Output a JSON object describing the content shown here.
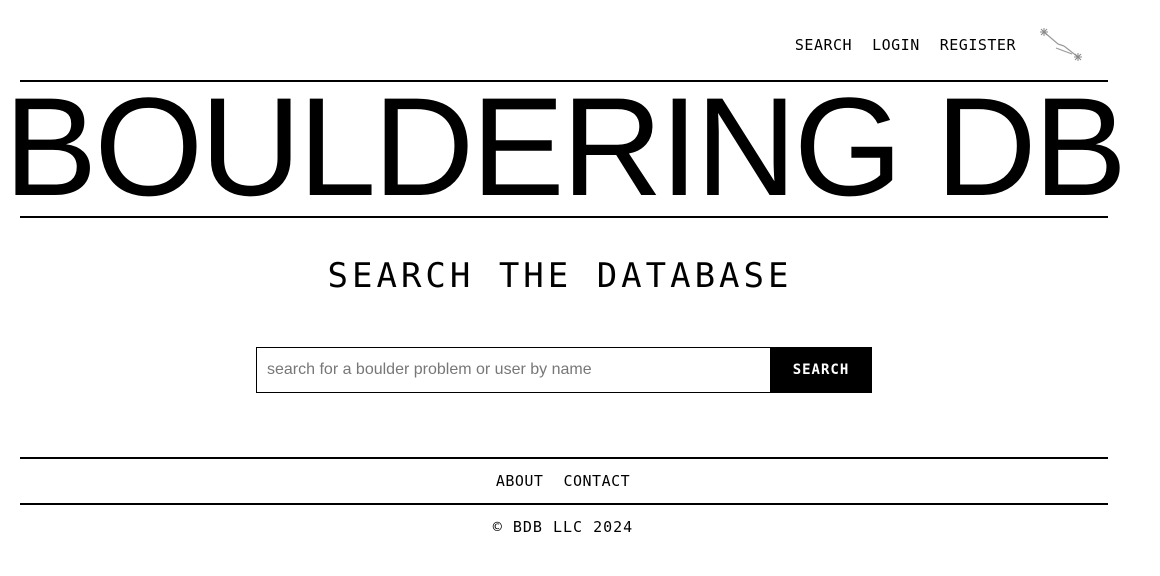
{
  "header": {
    "nav": [
      {
        "label": "SEARCH"
      },
      {
        "label": "LOGIN"
      },
      {
        "label": "REGISTER"
      }
    ],
    "logo_icon": "constellation-icon"
  },
  "title": "BOULDERING DB",
  "main": {
    "heading": "SEARCH THE DATABASE",
    "search": {
      "placeholder": "search for a boulder problem or user by name",
      "value": "",
      "button_label": "SEARCH"
    }
  },
  "footer": {
    "links": [
      {
        "label": "ABOUT"
      },
      {
        "label": "CONTACT"
      }
    ],
    "copyright": "© BDB LLC 2024"
  },
  "colors": {
    "text": "#000000",
    "background": "#ffffff",
    "button_bg": "#000000",
    "button_text": "#ffffff",
    "placeholder": "#777777"
  }
}
